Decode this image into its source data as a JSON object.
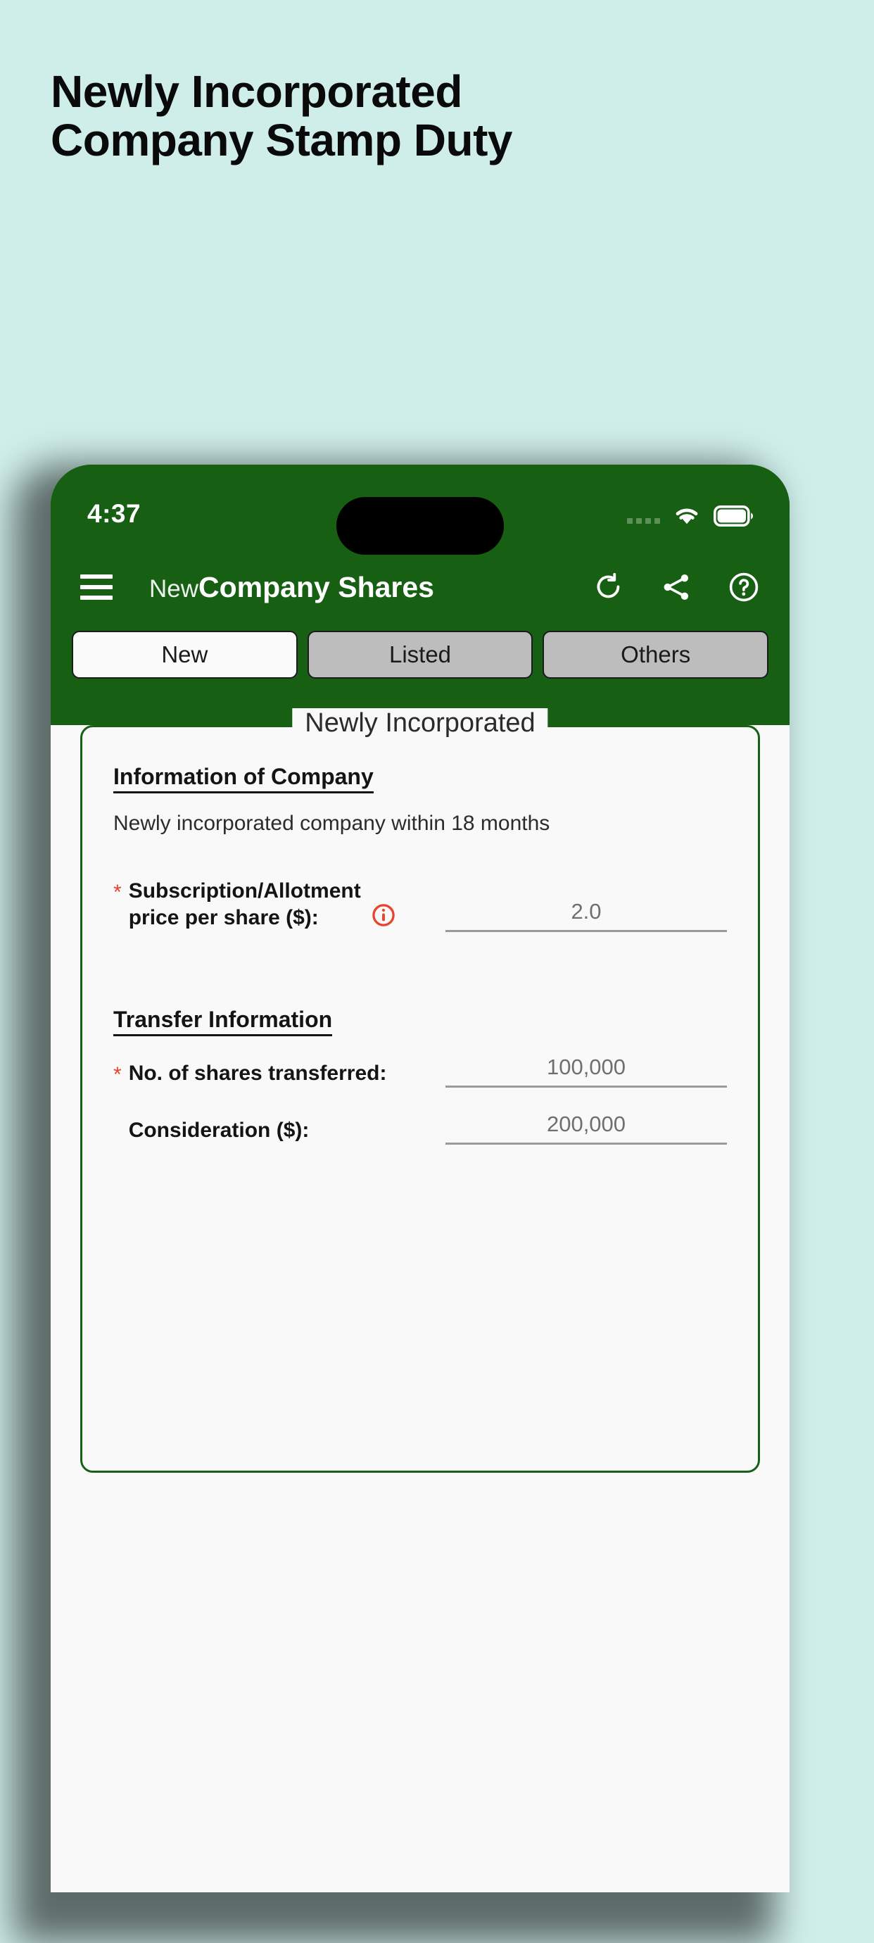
{
  "promo": {
    "headline": "Newly Incorporated Company Stamp Duty",
    "background_color": "#cfeeea"
  },
  "status_bar": {
    "time": "4:37",
    "icons": [
      "signal-dots-icon",
      "wifi-icon",
      "battery-icon"
    ]
  },
  "app_bar": {
    "menu_icon": "hamburger-icon",
    "title_light": "New",
    "title_bold": "Company Shares",
    "actions": [
      {
        "name": "refresh-icon",
        "label": "Refresh"
      },
      {
        "name": "share-icon",
        "label": "Share"
      },
      {
        "name": "help-icon",
        "label": "Help"
      }
    ],
    "background_color": "#175f13"
  },
  "tabs": [
    {
      "label": "New",
      "active": true
    },
    {
      "label": "Listed",
      "active": false
    },
    {
      "label": "Others",
      "active": false
    }
  ],
  "form": {
    "legend": "Newly Incorporated",
    "company_section": {
      "heading": "Information of Company",
      "note": "Newly incorporated company within 18 months"
    },
    "price_field": {
      "required_marker": "*",
      "label_line1": "Subscription/Allotment",
      "label_line2": "price per share ($):",
      "info_icon": "info-circle-icon",
      "value": "2.0"
    },
    "transfer_section": {
      "heading": "Transfer Information"
    },
    "shares_field": {
      "required_marker": "*",
      "label": "No. of shares transferred:",
      "value": "100,000"
    },
    "consideration_field": {
      "label": "Consideration ($):",
      "value": "200,000"
    }
  },
  "colors": {
    "brand_green": "#175f13",
    "card_border_green": "#176117",
    "required_red": "#e3452f",
    "info_icon_red": "#e8432e",
    "page_background": "#cfeeea",
    "content_background": "#f9f9f9"
  }
}
